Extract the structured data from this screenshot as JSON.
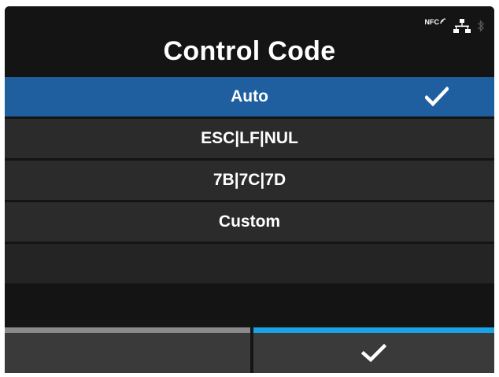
{
  "header": {
    "title": "Control Code",
    "status_icons": [
      "nfc-icon",
      "network-icon",
      "bluetooth-icon"
    ],
    "nfc_label": "NFC"
  },
  "menu": {
    "items": [
      {
        "label": "Auto",
        "selected": true,
        "checked": true
      },
      {
        "label": "ESC|LF|NUL",
        "selected": false,
        "checked": false
      },
      {
        "label": "7B|7C|7D",
        "selected": false,
        "checked": false
      },
      {
        "label": "Custom",
        "selected": false,
        "checked": false
      }
    ]
  },
  "softkeys": {
    "left": {
      "icon": "",
      "indicator_color": "#8a8a8a"
    },
    "right": {
      "icon": "check-icon",
      "indicator_color": "#19a3e6"
    }
  },
  "colors": {
    "background": "#141414",
    "row": "#2b2b2b",
    "selected_row": "#1f5fa0",
    "text": "#ffffff"
  }
}
